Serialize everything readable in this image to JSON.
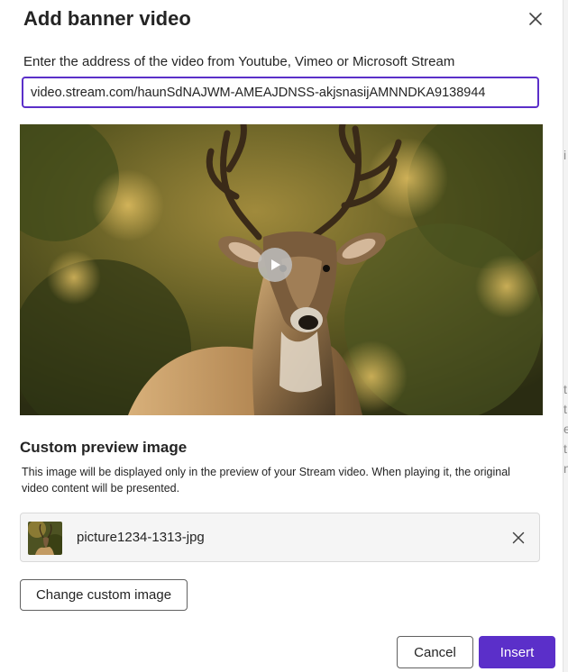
{
  "dialog": {
    "title": "Add banner video",
    "close_icon": "close-icon"
  },
  "url": {
    "label": "Enter the address of the video from Youtube, Vimeo or Microsoft Stream",
    "value": "video.stream.com/haunSdNAJWM-AMEAJDNSS-akjsnasijAMNNDKA9138944"
  },
  "preview": {
    "image": "deer-photo",
    "play_icon": "play-icon"
  },
  "custom_preview": {
    "title": "Custom preview image",
    "description": "This image will be displayed only in the preview of your Stream video. When playing it, the original video content will be presented.",
    "file_name": "picture1234-1313-jpg",
    "remove_icon": "close-icon",
    "change_label": "Change custom image"
  },
  "footer": {
    "cancel_label": "Cancel",
    "insert_label": "Insert"
  },
  "colors": {
    "accent": "#5b2fc9",
    "text": "#242424",
    "border": "#616161"
  }
}
